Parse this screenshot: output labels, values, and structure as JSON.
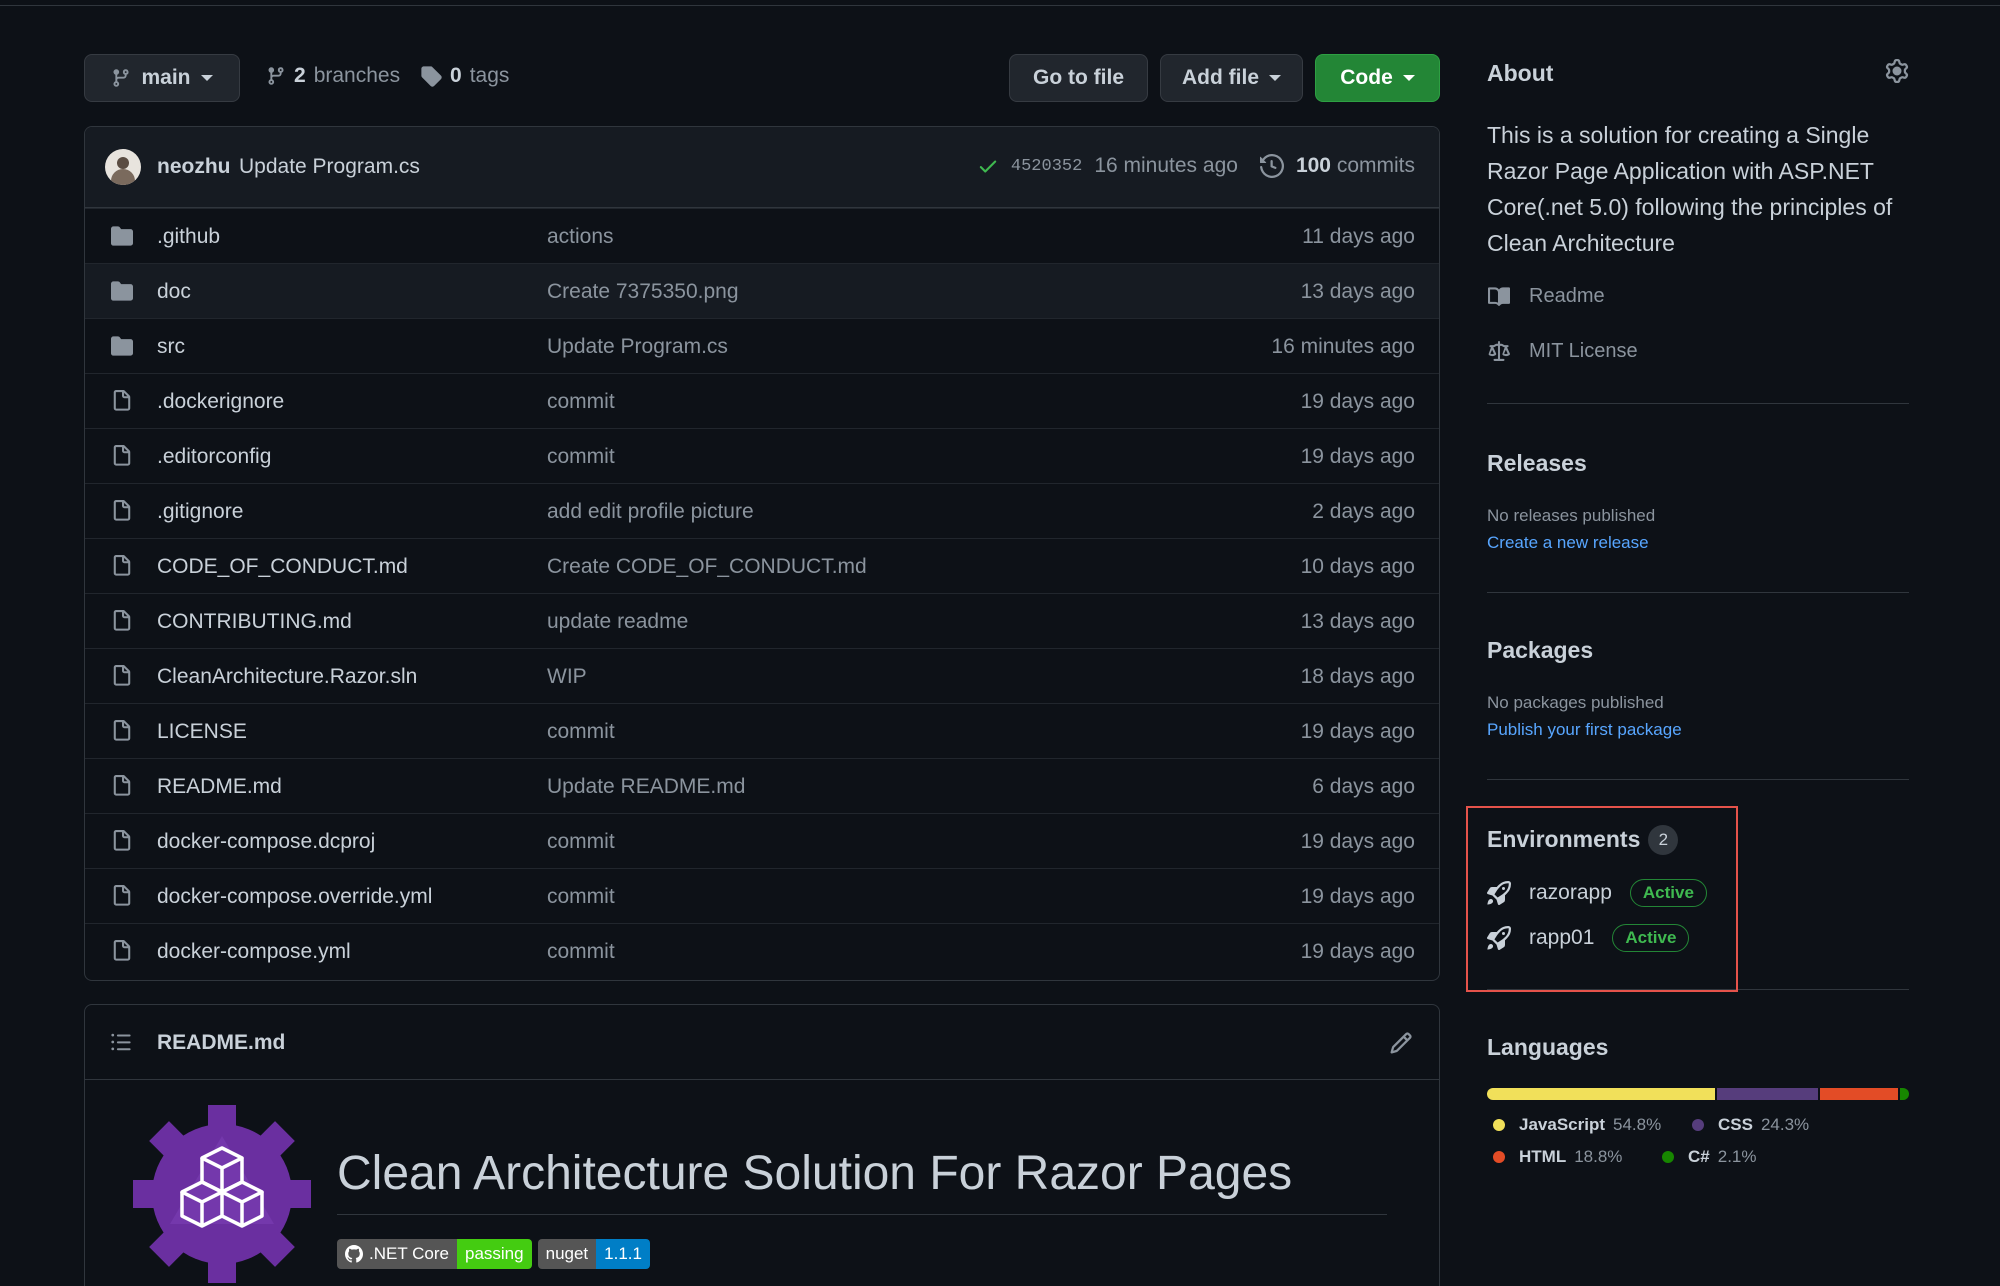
{
  "toolbar": {
    "branch": "main",
    "branches_count": "2",
    "branches_label": "branches",
    "tags_count": "0",
    "tags_label": "tags",
    "go_to_file": "Go to file",
    "add_file": "Add file",
    "code": "Code"
  },
  "commit": {
    "user": "neozhu",
    "message": "Update Program.cs",
    "sha": "4520352",
    "time": "16 minutes ago",
    "commits_count": "100",
    "commits_label": "commits"
  },
  "files": [
    {
      "name": ".github",
      "type": "folder",
      "message": "actions",
      "age": "11 days ago"
    },
    {
      "name": "doc",
      "type": "folder",
      "message": "Create 7375350.png",
      "age": "13 days ago"
    },
    {
      "name": "src",
      "type": "folder",
      "message": "Update Program.cs",
      "age": "16 minutes ago"
    },
    {
      "name": ".dockerignore",
      "type": "file",
      "message": "commit",
      "age": "19 days ago"
    },
    {
      "name": ".editorconfig",
      "type": "file",
      "message": "commit",
      "age": "19 days ago"
    },
    {
      "name": ".gitignore",
      "type": "file",
      "message": "add edit profile picture",
      "age": "2 days ago"
    },
    {
      "name": "CODE_OF_CONDUCT.md",
      "type": "file",
      "message": "Create CODE_OF_CONDUCT.md",
      "age": "10 days ago"
    },
    {
      "name": "CONTRIBUTING.md",
      "type": "file",
      "message": "update readme",
      "age": "13 days ago"
    },
    {
      "name": "CleanArchitecture.Razor.sln",
      "type": "file",
      "message": "WIP",
      "age": "18 days ago"
    },
    {
      "name": "LICENSE",
      "type": "file",
      "message": "commit",
      "age": "19 days ago"
    },
    {
      "name": "README.md",
      "type": "file",
      "message": "Update README.md",
      "age": "6 days ago"
    },
    {
      "name": "docker-compose.dcproj",
      "type": "file",
      "message": "commit",
      "age": "19 days ago"
    },
    {
      "name": "docker-compose.override.yml",
      "type": "file",
      "message": "commit",
      "age": "19 days ago"
    },
    {
      "name": "docker-compose.yml",
      "type": "file",
      "message": "commit",
      "age": "19 days ago"
    }
  ],
  "readme": {
    "filename": "README.md",
    "heading": "Clean Architecture Solution For Razor Pages",
    "badges": [
      {
        "label": ".NET Core",
        "value": "passing",
        "color": "#4c1"
      },
      {
        "label": "nuget",
        "value": "1.1.1",
        "color": "#007ec6"
      }
    ]
  },
  "about": {
    "title": "About",
    "description": "This is a solution for creating a Single Razor Page Application with ASP.NET Core(.net 5.0) following the principles of Clean Architecture",
    "readme_link": "Readme",
    "license_link": "MIT License"
  },
  "releases": {
    "title": "Releases",
    "text": "No releases published",
    "link": "Create a new release"
  },
  "packages": {
    "title": "Packages",
    "text": "No packages published",
    "link": "Publish your first package"
  },
  "environments": {
    "title": "Environments",
    "count": "2",
    "items": [
      {
        "name": "razorapp",
        "status": "Active"
      },
      {
        "name": "rapp01",
        "status": "Active"
      }
    ]
  },
  "languages": {
    "title": "Languages",
    "items": [
      {
        "name": "JavaScript",
        "percent": "54.8%",
        "value": 54.8,
        "color": "#f1e05a"
      },
      {
        "name": "CSS",
        "percent": "24.3%",
        "value": 24.3,
        "color": "#563d7c"
      },
      {
        "name": "HTML",
        "percent": "18.8%",
        "value": 18.8,
        "color": "#e34c26"
      },
      {
        "name": "C#",
        "percent": "2.1%",
        "value": 2.1,
        "color": "#178600"
      }
    ]
  }
}
